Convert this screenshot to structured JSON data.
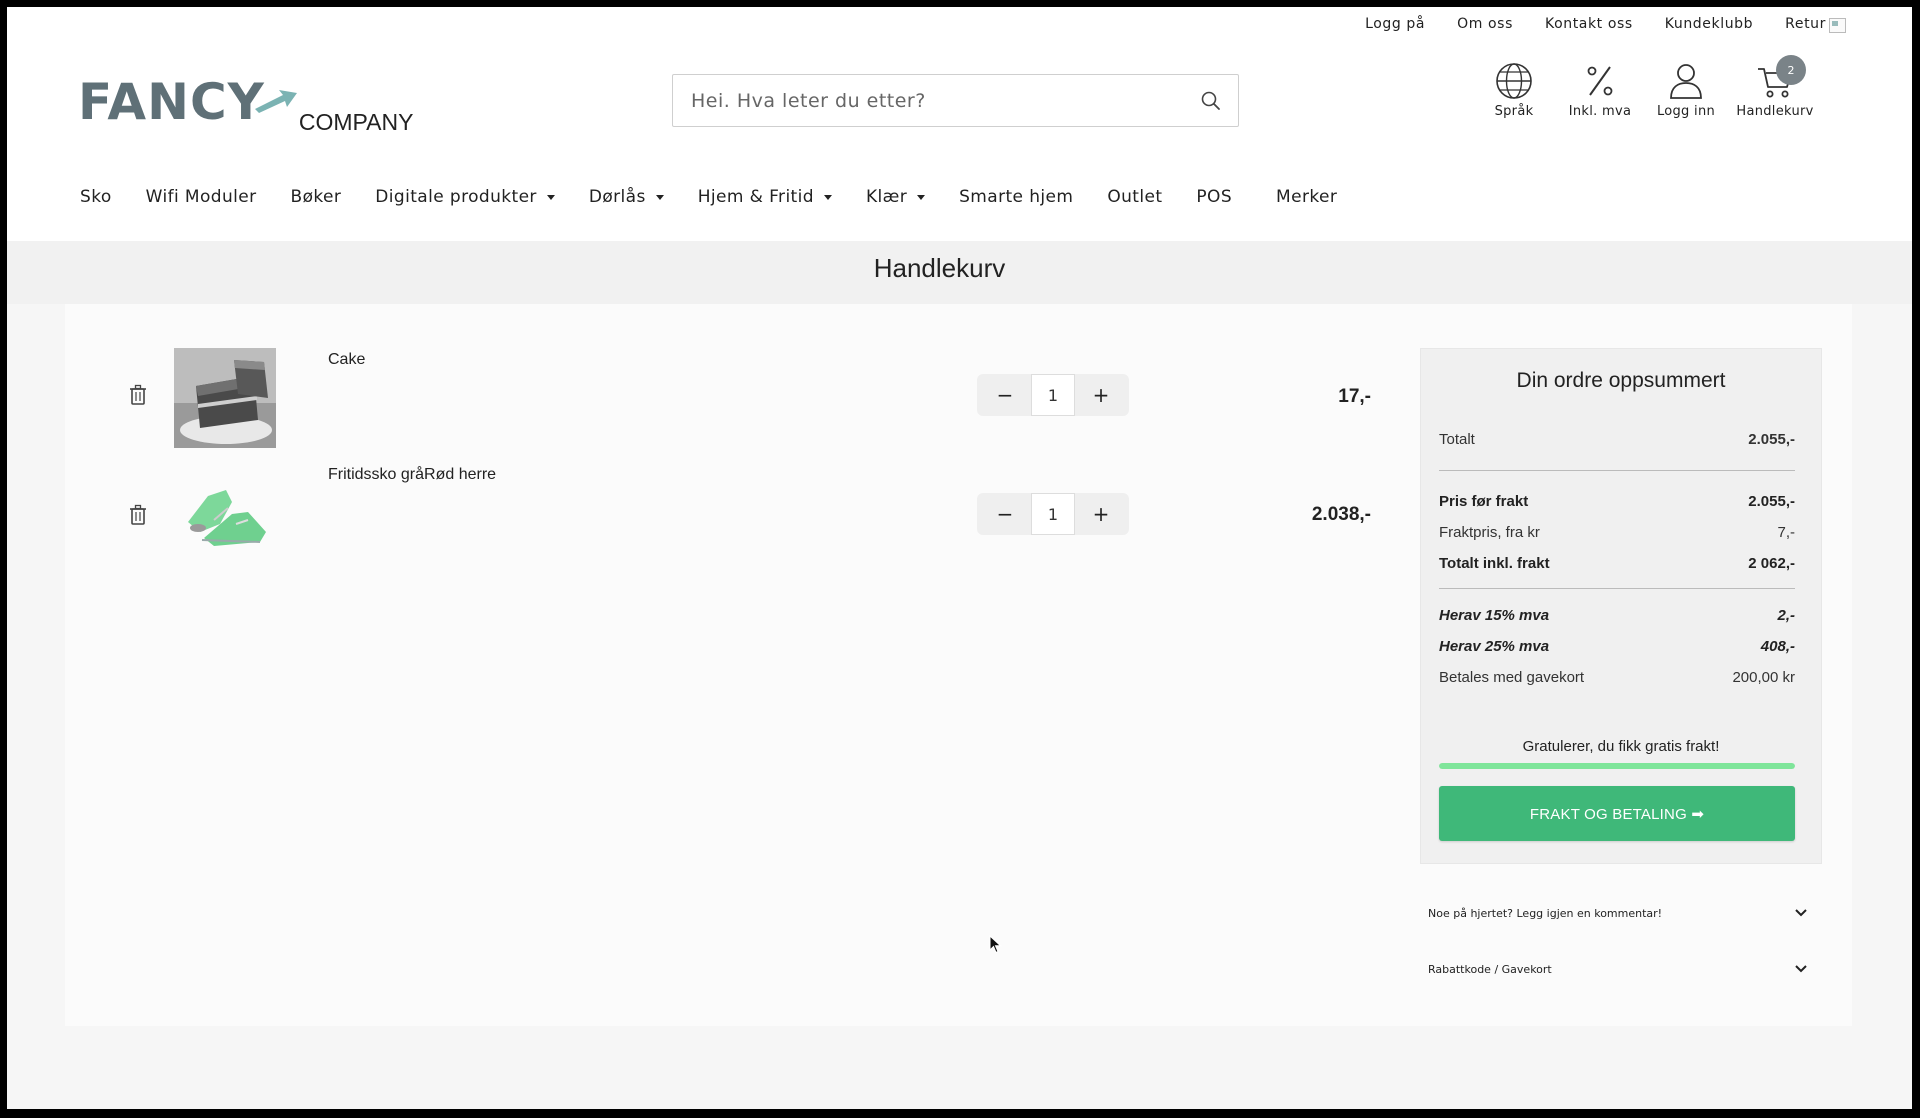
{
  "topbar": {
    "links": [
      "Logg på",
      "Om oss",
      "Kontakt oss",
      "Kundeklubb",
      "Retur"
    ]
  },
  "header": {
    "logo_text": "FANCY",
    "logo_sub": "COMPANY",
    "search_placeholder": "Hei. Hva leter du etter?",
    "icons": {
      "language": "Språk",
      "vat": "Inkl. mva",
      "login": "Logg inn",
      "cart": "Handlekurv"
    },
    "cart_count": "2",
    "brand_color": "#5f7077",
    "accent_color": "#7bb3b3"
  },
  "nav": {
    "items": [
      {
        "label": "Sko",
        "dropdown": false
      },
      {
        "label": "Wifi Moduler",
        "dropdown": false
      },
      {
        "label": "Bøker",
        "dropdown": false
      },
      {
        "label": "Digitale produkter",
        "dropdown": true
      },
      {
        "label": "Dørlås",
        "dropdown": true
      },
      {
        "label": "Hjem & Fritid",
        "dropdown": true
      },
      {
        "label": "Klær",
        "dropdown": true
      },
      {
        "label": "Smarte hjem",
        "dropdown": false
      },
      {
        "label": "Outlet",
        "dropdown": false
      },
      {
        "label": "POS",
        "dropdown": false
      },
      {
        "label": "Merker",
        "dropdown": false
      }
    ]
  },
  "page": {
    "title": "Handlekurv"
  },
  "cart": {
    "items": [
      {
        "name": "Cake",
        "quantity": "1",
        "price": "17,-",
        "image_icon": "cake-slice-image"
      },
      {
        "name": "Fritidssko gråRød herre",
        "quantity": "1",
        "price": "2.038,-",
        "image_icon": "sneaker-image"
      }
    ],
    "minus_label": "−",
    "plus_label": "+"
  },
  "summary": {
    "title": "Din ordre oppsummert",
    "total_label": "Totalt",
    "total_value": "2.055,-",
    "pre_shipping_label": "Pris før frakt",
    "pre_shipping_value": "2.055,-",
    "shipping_label": "Fraktpris, fra kr",
    "shipping_value": "7,-",
    "total_incl_label": "Totalt inkl. frakt",
    "total_incl_value": "2 062,-",
    "vat15_label": "Herav 15% mva",
    "vat15_value": "2,-",
    "vat25_label": "Herav 25% mva",
    "vat25_value": "408,-",
    "giftcard_label": "Betales med gavekort",
    "giftcard_value": "200,00 kr",
    "free_shipping_text": "Gratulerer, du fikk gratis frakt!",
    "free_shipping_progress": 1.0,
    "checkout_label": "FRAKT OG BETALING ➡",
    "checkout_color": "#3fb879"
  },
  "accordions": {
    "comment": "Noe på hjertet? Legg igjen en kommentar!",
    "discount": "Rabattkode / Gavekort"
  }
}
